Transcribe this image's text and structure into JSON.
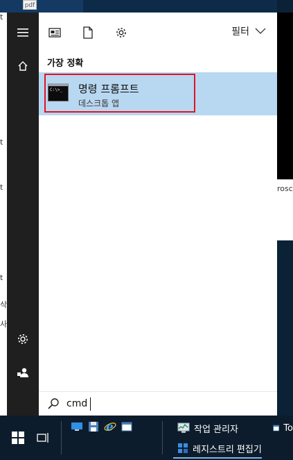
{
  "desktop": {
    "pdf_label": "pdf",
    "right_edge_text": "rosc",
    "left_edge_texts": [
      "t",
      "t",
      "t",
      "t",
      "삭",
      "사"
    ]
  },
  "start_menu": {
    "toolbar": {
      "filter_label": "필터"
    },
    "section_title": "가장 정확",
    "best_match": {
      "app_name": "명령 프롬프트",
      "app_type": "데스크톱 앱",
      "icon_text": "C:\\>_"
    },
    "search": {
      "value": "cmd",
      "placeholder": ""
    }
  },
  "taskbar": {
    "apps": [
      {
        "label": "작업 관리자",
        "icon": "task-manager-icon"
      },
      {
        "label": "레지스트리 편집기",
        "icon": "registry-editor-icon",
        "active": true
      },
      {
        "label": "To",
        "icon": "window-icon"
      }
    ]
  },
  "colors": {
    "highlight_blue": "#b8d7f1",
    "selection_border": "#e0141e",
    "rail_bg": "#1f1f1f",
    "taskbar_bg": "#0d1c2c"
  }
}
